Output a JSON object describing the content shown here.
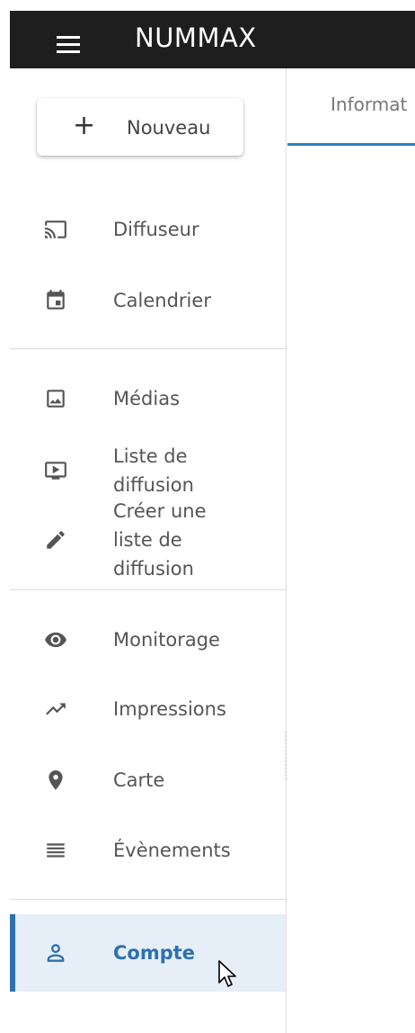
{
  "app": {
    "title": "NUMMAX"
  },
  "new_button": {
    "icon": "plus-icon",
    "label": "Nouveau"
  },
  "nav": {
    "items": [
      {
        "icon": "cast-icon",
        "label": "Diffuseur"
      },
      {
        "icon": "calendar-icon",
        "label": "Calendrier"
      },
      {
        "icon": "image-icon",
        "label": "Médias"
      },
      {
        "icon": "tv-playlist-icon",
        "label": "Liste de diffusion"
      },
      {
        "icon": "pencil-icon",
        "label": "Créer une liste de diffusion"
      },
      {
        "icon": "eye-icon",
        "label": "Monitorage"
      },
      {
        "icon": "trending-up-icon",
        "label": "Impressions"
      },
      {
        "icon": "map-pin-icon",
        "label": "Carte"
      },
      {
        "icon": "list-icon",
        "label": "Évènements"
      },
      {
        "icon": "user-icon",
        "label": "Compte",
        "active": true
      }
    ]
  },
  "tabs": [
    {
      "label": "Informat"
    }
  ],
  "colors": {
    "topbar": "#1e1e1e",
    "accent": "#2f6fb0",
    "active_bg": "#e6eef8"
  }
}
